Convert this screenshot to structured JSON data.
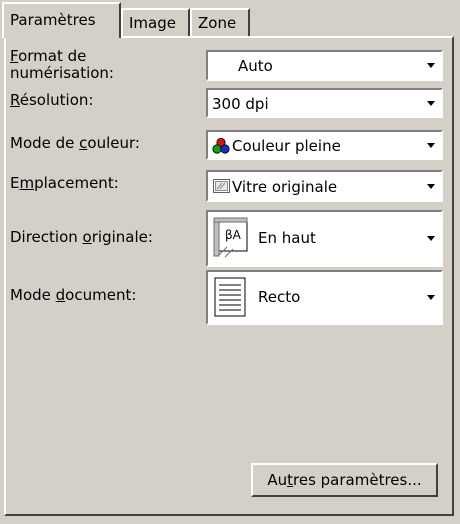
{
  "tabs": [
    {
      "label": "Paramètres"
    },
    {
      "label": "Image"
    },
    {
      "label": "Zone"
    }
  ],
  "fields": {
    "format": {
      "label_line1_key": "F",
      "label_line1_rest": "ormat de",
      "label_line2": "numérisation:",
      "value": "Auto"
    },
    "resolution": {
      "label_key": "R",
      "label_rest": "ésolution:",
      "value": "300 dpi"
    },
    "color_mode": {
      "label_pre": "Mode de ",
      "label_key": "c",
      "label_rest": "ouleur:",
      "value": "Couleur pleine",
      "icon": "color-circles-icon"
    },
    "location": {
      "label_pre": "E",
      "label_key": "m",
      "label_rest": "placement:",
      "value": "Vitre originale",
      "icon": "glass-platen-icon"
    },
    "direction": {
      "label_pre": "Direction ",
      "label_key": "o",
      "label_rest": "riginale:",
      "value": "En haut",
      "icon": "orientation-top-icon"
    },
    "doc_mode": {
      "label_pre": "Mode ",
      "label_key": "d",
      "label_rest": "ocument:",
      "value": "Recto",
      "icon": "single-sided-icon"
    }
  },
  "other_settings_button": {
    "pre": "Au",
    "key": "t",
    "rest": "res paramètres..."
  },
  "colors": {
    "face": "#d4d0c8",
    "field": "#ffffff"
  }
}
